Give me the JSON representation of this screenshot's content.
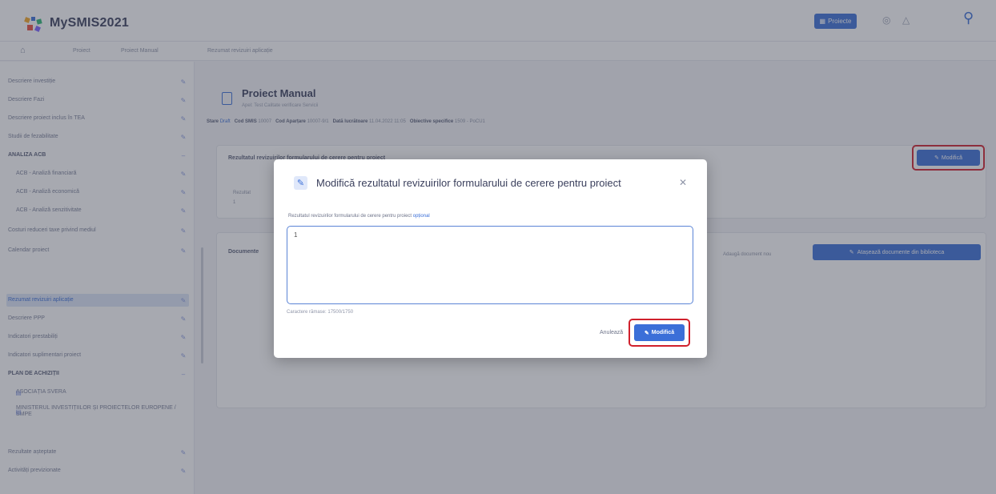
{
  "app": {
    "title": "MySMIS2021"
  },
  "header": {
    "projects_button": "Proiecte",
    "icons": [
      "grid-icon",
      "bell-icon",
      "user-icon",
      "key-icon"
    ]
  },
  "breadcrumb": {
    "items": [
      "Proiect",
      "Proiect Manual",
      "Rezumat revizuiri aplicație"
    ]
  },
  "sidebar": {
    "items": [
      {
        "label": "Descriere investiție",
        "type": "item"
      },
      {
        "label": "Descriere Fazi",
        "type": "item"
      },
      {
        "label": "Descriere proiect inclus în TEA",
        "type": "item"
      },
      {
        "label": "Studii de fezabilitate",
        "type": "item"
      },
      {
        "label": "ANALIZA ACB",
        "type": "section"
      },
      {
        "label": "ACB - Analiză financiară",
        "type": "sub"
      },
      {
        "label": "ACB - Analiză economică",
        "type": "sub"
      },
      {
        "label": "ACB - Analiză senzitivitate",
        "type": "sub"
      },
      {
        "label": "Costuri reduceri taxe privind mediul",
        "type": "item"
      },
      {
        "label": "Calendar proiect",
        "type": "item"
      },
      {
        "label": "Rezumat revizuiri aplicație",
        "type": "active"
      },
      {
        "label": "Descriere PPP",
        "type": "item"
      },
      {
        "label": "Indicatori prestabiliți",
        "type": "item"
      },
      {
        "label": "Indicatori suplimentari proiect",
        "type": "item"
      },
      {
        "label": "PLAN DE ACHIZIȚII",
        "type": "section"
      },
      {
        "label": "ASOCIAȚIA SVERA",
        "type": "entity"
      },
      {
        "label": "MINISTERUL INVESTIȚIILOR ȘI PROIECTELOR EUROPENE / SMPE",
        "type": "entity"
      },
      {
        "label": "Rezultate așteptate",
        "type": "item"
      },
      {
        "label": "Activități previzionate",
        "type": "item"
      }
    ]
  },
  "page": {
    "title": "Proiect Manual",
    "subtitle": "Apel: Test Calitate verificare Servicii",
    "meta": {
      "status_key": "Stare",
      "status_value": "Draft",
      "smis_key": "Cod SMIS",
      "smis_value": "10007",
      "cod_key": "Cod Aparțare",
      "cod_value": "10007-9/1",
      "date_key": "Dată lucrătoare",
      "date_value": "11.04.2022 11:05",
      "obj_key": "Obiective specifice",
      "obj_value": "1509 - PoCU1"
    }
  },
  "card1": {
    "heading": "Rezultatul revizuirilor formularului de cerere pentru proiect",
    "field_label": "Rezultat",
    "field_value": "1",
    "modify_button": "Modifică"
  },
  "card2": {
    "heading": "Documente",
    "add_doc": "Adaugă document nou",
    "library_button": "Atașează documente din biblioteca"
  },
  "modal": {
    "title": "Modifică rezultatul revizuirilor formularului de cerere pentru proiect",
    "field_label": "Rezultatul revizuirilor formularului de cerere pentru proiect",
    "optional": "opțional",
    "value": "1",
    "char_count": "Caractere rămase: 17500/1750",
    "cancel": "Anulează",
    "submit": "Modifică"
  },
  "colors": {
    "accent": "#3b6fd8",
    "highlight": "#d0202c"
  }
}
